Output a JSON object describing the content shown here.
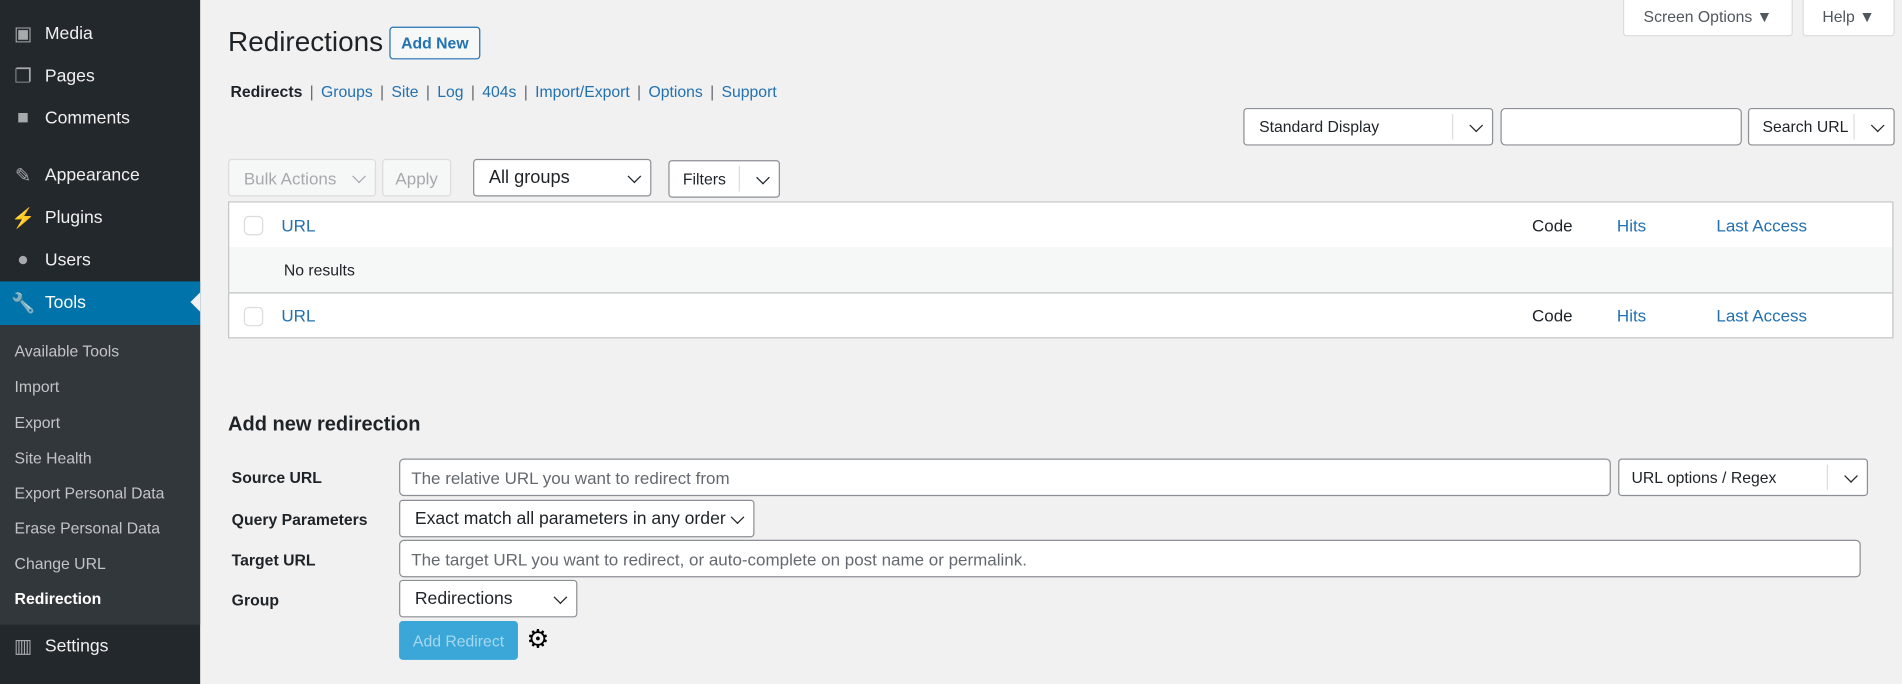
{
  "sidebar": {
    "items": [
      {
        "label": "Media",
        "icon": "media-icon"
      },
      {
        "label": "Pages",
        "icon": "pages-icon"
      },
      {
        "label": "Comments",
        "icon": "comments-icon"
      },
      {
        "label": "Appearance",
        "icon": "appearance-icon"
      },
      {
        "label": "Plugins",
        "icon": "plugins-icon"
      },
      {
        "label": "Users",
        "icon": "users-icon"
      },
      {
        "label": "Tools",
        "icon": "tools-icon",
        "active": true
      },
      {
        "label": "Settings",
        "icon": "settings-icon"
      }
    ],
    "submenu": [
      "Available Tools",
      "Import",
      "Export",
      "Site Health",
      "Export Personal Data",
      "Erase Personal Data",
      "Change URL",
      "Redirection"
    ],
    "current_submenu": "Redirection"
  },
  "top": {
    "screen_options": "Screen Options ▼",
    "help": "Help ▼"
  },
  "header": {
    "title": "Redirections",
    "add_new": "Add New"
  },
  "subnav": {
    "items": [
      "Redirects",
      "Groups",
      "Site",
      "Log",
      "404s",
      "Import/Export",
      "Options",
      "Support"
    ],
    "current": "Redirects"
  },
  "filters": {
    "display": "Standard Display",
    "search_value": "",
    "search_button": "Search URL",
    "bulk_actions": "Bulk Actions",
    "apply": "Apply",
    "groups": "All groups",
    "filters": "Filters"
  },
  "table": {
    "columns": [
      "URL",
      "Code",
      "Hits",
      "Last Access"
    ],
    "empty": "No results"
  },
  "form": {
    "heading": "Add new redirection",
    "source_label": "Source URL",
    "source_placeholder": "The relative URL you want to redirect from",
    "url_options": "URL options / Regex",
    "query_label": "Query Parameters",
    "query_value": "Exact match all parameters in any order",
    "target_label": "Target URL",
    "target_placeholder": "The target URL you want to redirect, or auto-complete on post name or permalink.",
    "group_label": "Group",
    "group_value": "Redirections",
    "submit": "Add Redirect"
  },
  "colors": {
    "sidebar": "#23282d",
    "active": "#0073aa",
    "link": "#2271b1",
    "submit": "#3aa7d8"
  }
}
